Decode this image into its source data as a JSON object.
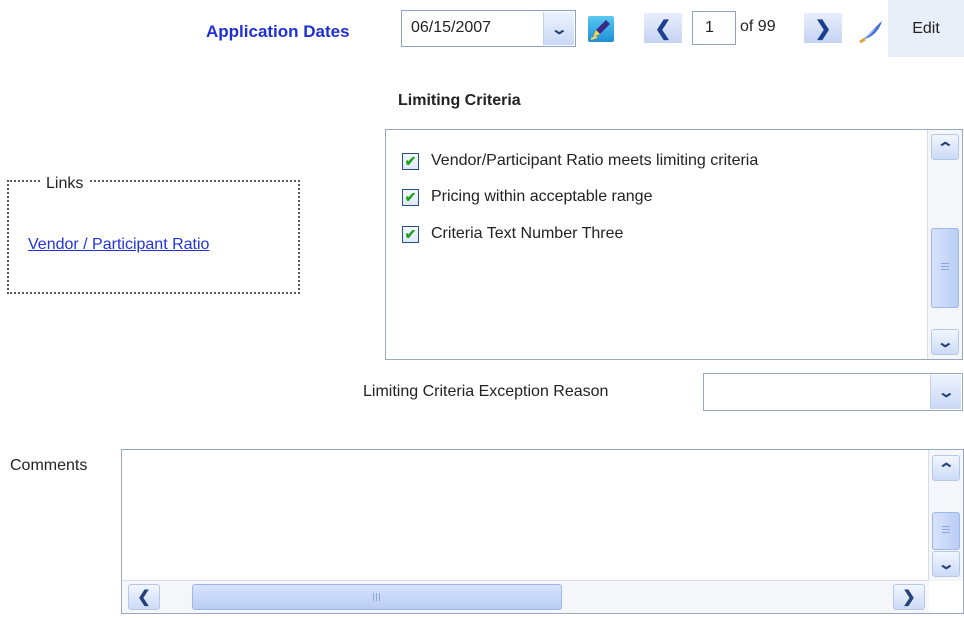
{
  "toolbar": {
    "application_dates_label": "Application Dates",
    "selected_date": "06/15/2007",
    "current_page": "1",
    "page_total_label": "of 99",
    "edit_label": "Edit"
  },
  "links": {
    "legend": "Links",
    "items": [
      {
        "label": "Vendor / Participant Ratio"
      }
    ]
  },
  "limiting_criteria": {
    "heading": "Limiting Criteria",
    "items": [
      {
        "label": "Vendor/Participant Ratio meets limiting criteria",
        "checked": true
      },
      {
        "label": "Pricing within acceptable range",
        "checked": true
      },
      {
        "label": "Criteria Text Number Three",
        "checked": true
      }
    ]
  },
  "exception": {
    "label": "Limiting Criteria Exception Reason",
    "value": ""
  },
  "comments": {
    "label": "Comments",
    "value": ""
  },
  "colors": {
    "accent": "#1f2fd6",
    "link": "#2233dd",
    "check": "#1fa31f"
  }
}
